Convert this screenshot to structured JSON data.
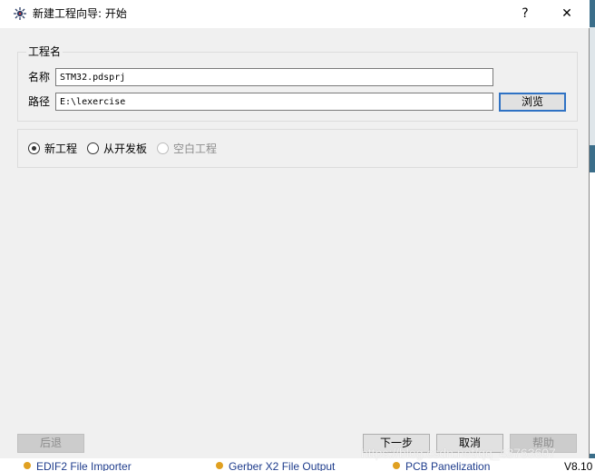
{
  "window": {
    "title": "新建工程向导: 开始",
    "help_glyph": "?",
    "close_glyph": "✕",
    "icon": "proteus-app-icon"
  },
  "project": {
    "group_title": "工程名",
    "name_label": "名称",
    "name_value": "STM32.pdsprj",
    "path_label": "路径",
    "path_value": "E:\\lexercise",
    "browse_label": "浏览"
  },
  "project_type": {
    "options": [
      {
        "label": "新工程",
        "selected": true,
        "enabled": true
      },
      {
        "label": "从开发板",
        "selected": false,
        "enabled": true
      },
      {
        "label": "空白工程",
        "selected": false,
        "enabled": false
      }
    ]
  },
  "footer": {
    "back_label": "后退",
    "next_label": "下一步",
    "cancel_label": "取消",
    "help_label": "帮助"
  },
  "background_app": {
    "items": [
      "EDIF2 File Importer",
      "Gerber X2 File Output",
      "PCB Panelization",
      "V8.10"
    ]
  },
  "watermark": "https://blog.csdn.net/qq_43763607",
  "colors": {
    "dialog_bg": "#f0f0f0",
    "focus_border": "#2f72c4",
    "button_bg": "#e1e1e1"
  }
}
